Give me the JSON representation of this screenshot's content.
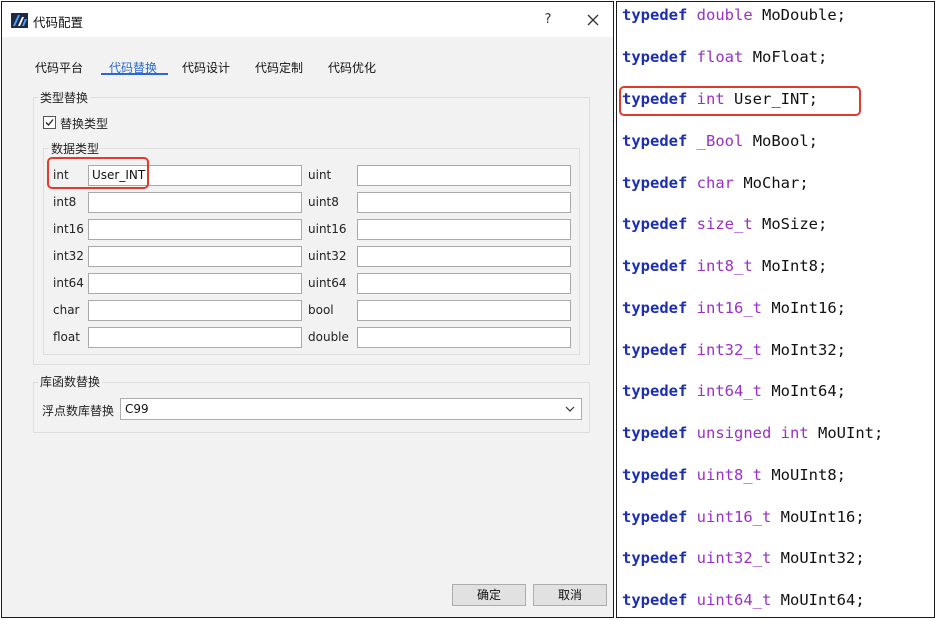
{
  "dialog": {
    "title": "代码配置",
    "help_label": "?",
    "tabs": [
      {
        "label": "代码平台",
        "active": false
      },
      {
        "label": "代码替换",
        "active": true
      },
      {
        "label": "代码设计",
        "active": false
      },
      {
        "label": "代码定制",
        "active": false
      },
      {
        "label": "代码优化",
        "active": false
      }
    ],
    "type_replace": {
      "group_title": "类型替换",
      "checkbox_label": "替换类型",
      "checkbox_checked": true,
      "data_types_title": "数据类型",
      "rows": [
        {
          "left_label": "int",
          "left_value": "User_INT",
          "right_label": "uint",
          "right_value": ""
        },
        {
          "left_label": "int8",
          "left_value": "",
          "right_label": "uint8",
          "right_value": ""
        },
        {
          "left_label": "int16",
          "left_value": "",
          "right_label": "uint16",
          "right_value": ""
        },
        {
          "left_label": "int32",
          "left_value": "",
          "right_label": "uint32",
          "right_value": ""
        },
        {
          "left_label": "int64",
          "left_value": "",
          "right_label": "uint64",
          "right_value": ""
        },
        {
          "left_label": "char",
          "left_value": "",
          "right_label": "bool",
          "right_value": ""
        },
        {
          "left_label": "float",
          "left_value": "",
          "right_label": "double",
          "right_value": ""
        }
      ]
    },
    "lib_replace": {
      "group_title": "库函数替换",
      "label": "浮点数库替换",
      "selected": "C99"
    },
    "ok_label": "确定",
    "cancel_label": "取消"
  },
  "code": {
    "lines": [
      {
        "kw": "typedef",
        "type": "double",
        "name": "MoDouble;"
      },
      {
        "kw": "typedef",
        "type": "float",
        "name": "MoFloat;"
      },
      {
        "kw": "typedef",
        "type": "int",
        "name": "User_INT;"
      },
      {
        "kw": "typedef",
        "type": "_Bool",
        "name": "MoBool;"
      },
      {
        "kw": "typedef",
        "type": "char",
        "name": "MoChar;"
      },
      {
        "kw": "typedef",
        "type": "size_t",
        "name": "MoSize;"
      },
      {
        "kw": "typedef",
        "type": "int8_t",
        "name": "MoInt8;"
      },
      {
        "kw": "typedef",
        "type": "int16_t",
        "name": "MoInt16;"
      },
      {
        "kw": "typedef",
        "type": "int32_t",
        "name": "MoInt32;"
      },
      {
        "kw": "typedef",
        "type": "int64_t",
        "name": "MoInt64;"
      },
      {
        "kw": "typedef",
        "type": "unsigned int",
        "name": "MoUInt;"
      },
      {
        "kw": "typedef",
        "type": "uint8_t",
        "name": "MoUInt8;"
      },
      {
        "kw": "typedef",
        "type": "uint16_t",
        "name": "MoUInt16;"
      },
      {
        "kw": "typedef",
        "type": "uint32_t",
        "name": "MoUInt32;"
      },
      {
        "kw": "typedef",
        "type": "uint64_t",
        "name": "MoUInt64;"
      }
    ]
  },
  "colors": {
    "accent": "#2a6ad0",
    "highlight": "#e23a2e",
    "keyword": "#1b2fb0",
    "type": "#9b30c8"
  },
  "icons": {
    "app": "app-logo-icon",
    "close": "close-icon",
    "dropdown": "chevron-down-icon",
    "checkbox": "checkmark-icon"
  }
}
